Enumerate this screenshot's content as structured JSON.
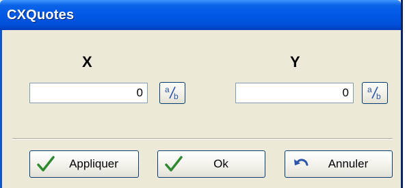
{
  "window": {
    "title": "CXQuotes"
  },
  "x": {
    "label": "X",
    "value": "0",
    "fraction_button": "a/b"
  },
  "y": {
    "label": "Y",
    "value": "0",
    "fraction_button": "a/b"
  },
  "buttons": {
    "apply": {
      "label": "Appliquer",
      "icon": "checkmark-icon"
    },
    "ok": {
      "label": "Ok",
      "icon": "checkmark-icon"
    },
    "cancel": {
      "label": "Annuler",
      "icon": "undo-arrow-icon"
    }
  },
  "colors": {
    "title_bar": "#0058e6",
    "dialog_bg": "#ece9d8",
    "checkmark": "#2f8a2f",
    "undo_arrow": "#2a55a8"
  }
}
